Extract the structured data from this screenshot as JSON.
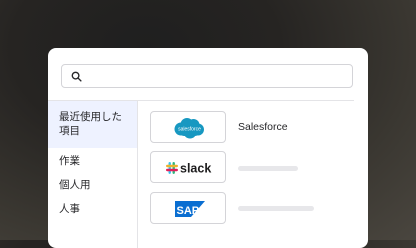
{
  "search": {
    "placeholder": "",
    "value": ""
  },
  "sidebar": {
    "items": [
      {
        "label": "最近使用した項目",
        "active": true
      },
      {
        "label": "作業",
        "active": false
      },
      {
        "label": "個人用",
        "active": false
      },
      {
        "label": "人事",
        "active": false
      }
    ]
  },
  "apps": [
    {
      "logo": "salesforce-logo",
      "logo_text": "salesforce",
      "name": "Salesforce"
    },
    {
      "logo": "slack-logo",
      "logo_text": "slack",
      "name": ""
    },
    {
      "logo": "sap-logo",
      "logo_text": "SAP",
      "name": ""
    }
  ],
  "colors": {
    "salesforce_blue": "#1798c1",
    "sap_blue": "#0a6ed1",
    "slack_aubergine": "#1d1c1d",
    "sidebar_active_bg": "#eef2ff"
  }
}
